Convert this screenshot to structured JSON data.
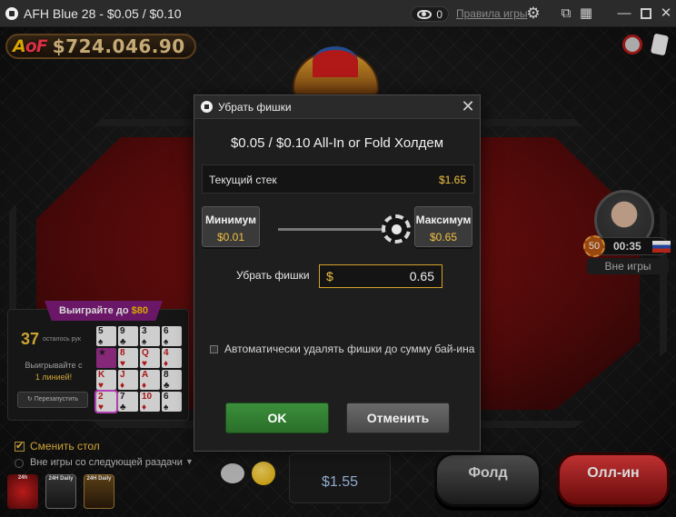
{
  "window": {
    "title": "AFH Blue 28 - $0.05 / $0.10",
    "observers": "0",
    "rules_link": "Правила игры"
  },
  "table": {
    "balance": "$724.046.90",
    "logo_left": "A",
    "logo_right": "oF",
    "seat": {
      "chips_badge": "50",
      "timer": "00:35",
      "status": "Вне игры",
      "flag": "russia-flag"
    },
    "promo": {
      "banner_prefix": "Выиграйте до ",
      "banner_amount": "$80",
      "remaining_count": "37",
      "remaining_label": "осталось рук",
      "win_text": "Выигрывайте с",
      "win_lines": "1 линией!",
      "reset_label": "Перезапустить",
      "cards": [
        {
          "rank": "5",
          "suit": "♠",
          "red": false
        },
        {
          "rank": "9",
          "suit": "♣",
          "red": false
        },
        {
          "rank": "3",
          "suit": "♠",
          "red": false
        },
        {
          "rank": "6",
          "suit": "♠",
          "red": false
        },
        {
          "rank": "★",
          "suit": "",
          "red": false
        },
        {
          "rank": "8",
          "suit": "♥",
          "red": true
        },
        {
          "rank": "Q",
          "suit": "♥",
          "red": true
        },
        {
          "rank": "4",
          "suit": "♦",
          "red": true
        },
        {
          "rank": "K",
          "suit": "♥",
          "red": true
        },
        {
          "rank": "J",
          "suit": "♦",
          "red": true
        },
        {
          "rank": "A",
          "suit": "♦",
          "red": true
        },
        {
          "rank": "8",
          "suit": "♣",
          "red": false
        },
        {
          "rank": "2",
          "suit": "♥",
          "red": true
        },
        {
          "rank": "7",
          "suit": "♣",
          "red": false
        },
        {
          "rank": "10",
          "suit": "♦",
          "red": true
        },
        {
          "rank": "6",
          "suit": "♠",
          "red": false
        }
      ]
    },
    "change_table_label": "Сменить стол",
    "sit_out_label": "Вне игры со следующей раздачи",
    "bonus_1": "24h",
    "bonus_2": "24H Daily",
    "bonus_3": "24H Daily",
    "pot": "$1.55",
    "fold_label": "Фолд",
    "allin_label": "Олл-ин"
  },
  "dialog": {
    "title": "Убрать фишки",
    "game": "$0.05 / $0.10 All-In or Fold Холдем",
    "current_stack_label": "Текущий стек",
    "current_stack_value": "$1.65",
    "min_label": "Минимум",
    "min_value": "$0.01",
    "max_label": "Максимум",
    "max_value": "$0.65",
    "slider_fraction": 1.0,
    "remove_label": "Убрать фишки",
    "currency": "$",
    "amount": "0.65",
    "auto_remove_label": "Автоматически удалять фишки до сумму бай-ина",
    "auto_remove_checked": false,
    "ok_label": "OK",
    "cancel_label": "Отменить"
  },
  "colors": {
    "accent_gold": "#f0c040",
    "ok_green": "#3b8f3b",
    "allin_red": "#e03a3a",
    "felt_red": "#8c1010"
  }
}
